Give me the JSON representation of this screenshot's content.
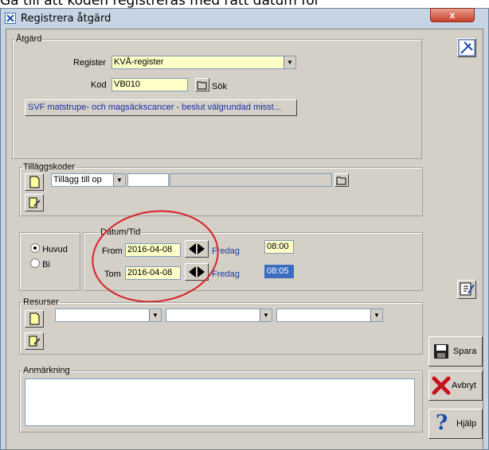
{
  "caption": "Gå till att koden registreras med rätt datum för",
  "window": {
    "title": "Registrera åtgärd",
    "close": "x"
  },
  "atgard": {
    "legend": "Åtgärd",
    "register_label": "Register",
    "register_value": "KVÅ-register",
    "kod_label": "Kod",
    "kod_value": "VB010",
    "sok_label": "Sök",
    "description": "SVF matstrupe- och magsäckscancer - beslut välgrundad misst..."
  },
  "tillagg": {
    "legend": "Tilläggskoder",
    "select_value": "Tillägg till op"
  },
  "type": {
    "huvud": "Huvud",
    "bi": "Bi"
  },
  "datum": {
    "legend": "Datum/Tid",
    "from_label": "From",
    "from_date": "2016-04-08",
    "from_day": "Fredag",
    "from_time": "08:00",
    "tom_label": "Tom",
    "tom_date": "2016-04-08",
    "tom_day": "Fredag",
    "tom_time": "08:05"
  },
  "resurser": {
    "legend": "Resurser"
  },
  "anmarkning": {
    "legend": "Anmärkning"
  },
  "buttons": {
    "spara": "Spara",
    "avbryt": "Avbryt",
    "hjalp": "Hjälp"
  },
  "colors": {
    "highlight_red": "#d8202a",
    "field_yellow": "#ffffc8",
    "link_blue": "#1a3aa0"
  }
}
